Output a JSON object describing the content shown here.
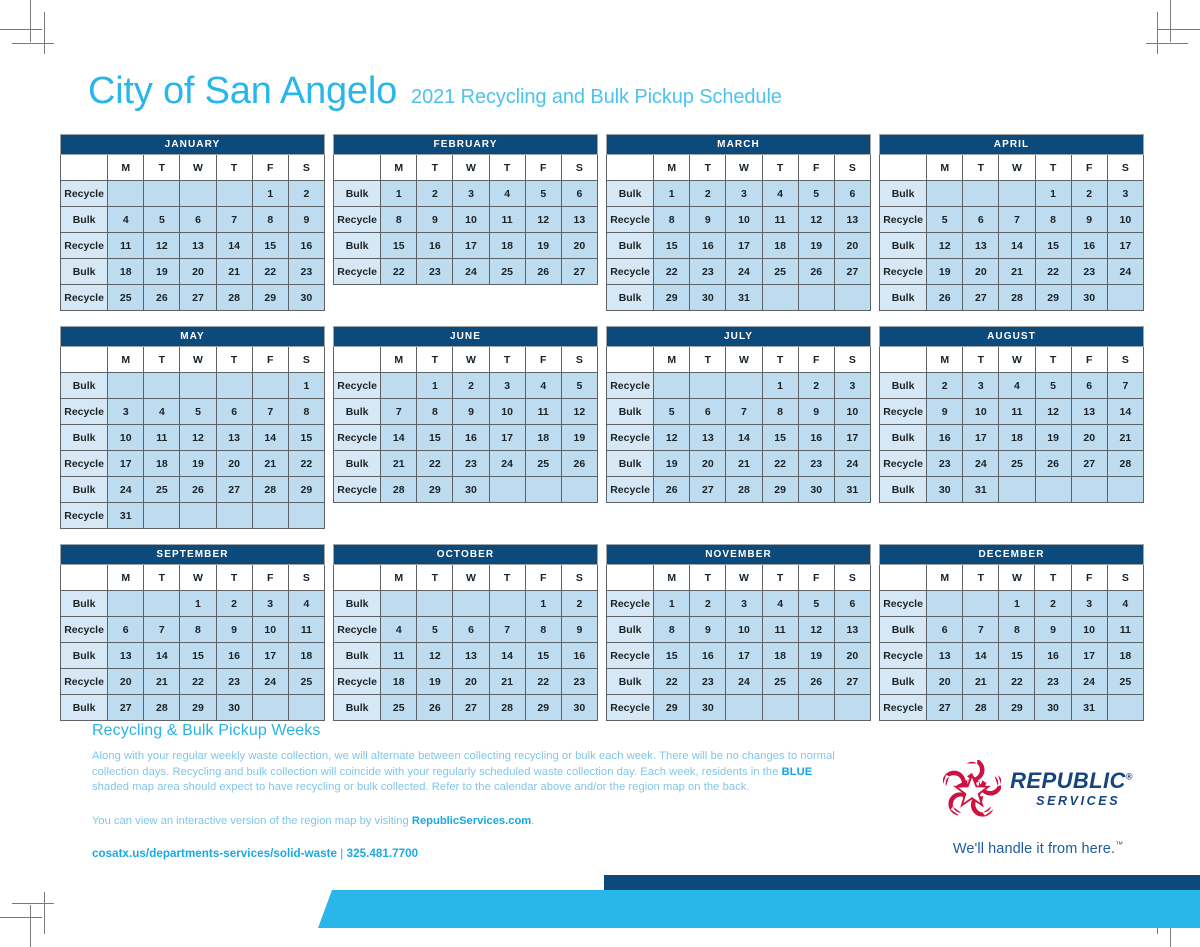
{
  "header": {
    "city": "City of San Angelo",
    "subtitle": "2021 Recycling and Bulk Pickup Schedule"
  },
  "colors": {
    "navy": "#0d4a7c",
    "cyan": "#29b6e8",
    "cell_blue": "#bddcef",
    "label_blue": "#d6e8f5",
    "logo_red": "#ce1141",
    "logo_navy": "#16457e"
  },
  "day_headers": [
    "M",
    "T",
    "W",
    "T",
    "F",
    "S"
  ],
  "labels": {
    "recycle": "Recycle",
    "bulk": "Bulk"
  },
  "calendar": {
    "year": "2021",
    "months": [
      {
        "name": "JANUARY",
        "weeks": [
          {
            "type": "Recycle",
            "days": [
              "",
              "",
              "",
              "",
              "1",
              "2"
            ]
          },
          {
            "type": "Bulk",
            "days": [
              "4",
              "5",
              "6",
              "7",
              "8",
              "9"
            ]
          },
          {
            "type": "Recycle",
            "days": [
              "11",
              "12",
              "13",
              "14",
              "15",
              "16"
            ]
          },
          {
            "type": "Bulk",
            "days": [
              "18",
              "19",
              "20",
              "21",
              "22",
              "23"
            ]
          },
          {
            "type": "Recycle",
            "days": [
              "25",
              "26",
              "27",
              "28",
              "29",
              "30"
            ]
          }
        ]
      },
      {
        "name": "FEBRUARY",
        "weeks": [
          {
            "type": "Bulk",
            "days": [
              "1",
              "2",
              "3",
              "4",
              "5",
              "6"
            ]
          },
          {
            "type": "Recycle",
            "days": [
              "8",
              "9",
              "10",
              "11",
              "12",
              "13"
            ]
          },
          {
            "type": "Bulk",
            "days": [
              "15",
              "16",
              "17",
              "18",
              "19",
              "20"
            ]
          },
          {
            "type": "Recycle",
            "days": [
              "22",
              "23",
              "24",
              "25",
              "26",
              "27"
            ]
          }
        ]
      },
      {
        "name": "MARCH",
        "weeks": [
          {
            "type": "Bulk",
            "days": [
              "1",
              "2",
              "3",
              "4",
              "5",
              "6"
            ]
          },
          {
            "type": "Recycle",
            "days": [
              "8",
              "9",
              "10",
              "11",
              "12",
              "13"
            ]
          },
          {
            "type": "Bulk",
            "days": [
              "15",
              "16",
              "17",
              "18",
              "19",
              "20"
            ]
          },
          {
            "type": "Recycle",
            "days": [
              "22",
              "23",
              "24",
              "25",
              "26",
              "27"
            ]
          },
          {
            "type": "Bulk",
            "days": [
              "29",
              "30",
              "31",
              "",
              "",
              ""
            ]
          }
        ]
      },
      {
        "name": "APRIL",
        "weeks": [
          {
            "type": "Bulk",
            "days": [
              "",
              "",
              "",
              "1",
              "2",
              "3"
            ]
          },
          {
            "type": "Recycle",
            "days": [
              "5",
              "6",
              "7",
              "8",
              "9",
              "10"
            ]
          },
          {
            "type": "Bulk",
            "days": [
              "12",
              "13",
              "14",
              "15",
              "16",
              "17"
            ]
          },
          {
            "type": "Recycle",
            "days": [
              "19",
              "20",
              "21",
              "22",
              "23",
              "24"
            ]
          },
          {
            "type": "Bulk",
            "days": [
              "26",
              "27",
              "28",
              "29",
              "30",
              ""
            ]
          }
        ]
      },
      {
        "name": "MAY",
        "weeks": [
          {
            "type": "Bulk",
            "days": [
              "",
              "",
              "",
              "",
              "",
              "1"
            ]
          },
          {
            "type": "Recycle",
            "days": [
              "3",
              "4",
              "5",
              "6",
              "7",
              "8"
            ]
          },
          {
            "type": "Bulk",
            "days": [
              "10",
              "11",
              "12",
              "13",
              "14",
              "15"
            ]
          },
          {
            "type": "Recycle",
            "days": [
              "17",
              "18",
              "19",
              "20",
              "21",
              "22"
            ]
          },
          {
            "type": "Bulk",
            "days": [
              "24",
              "25",
              "26",
              "27",
              "28",
              "29"
            ]
          },
          {
            "type": "Recycle",
            "days": [
              "31",
              "",
              "",
              "",
              "",
              ""
            ]
          }
        ]
      },
      {
        "name": "JUNE",
        "weeks": [
          {
            "type": "Recycle",
            "days": [
              "",
              "1",
              "2",
              "3",
              "4",
              "5"
            ]
          },
          {
            "type": "Bulk",
            "days": [
              "7",
              "8",
              "9",
              "10",
              "11",
              "12"
            ]
          },
          {
            "type": "Recycle",
            "days": [
              "14",
              "15",
              "16",
              "17",
              "18",
              "19"
            ]
          },
          {
            "type": "Bulk",
            "days": [
              "21",
              "22",
              "23",
              "24",
              "25",
              "26"
            ]
          },
          {
            "type": "Recycle",
            "days": [
              "28",
              "29",
              "30",
              "",
              "",
              ""
            ]
          }
        ]
      },
      {
        "name": "JULY",
        "weeks": [
          {
            "type": "Recycle",
            "days": [
              "",
              "",
              "",
              "1",
              "2",
              "3"
            ]
          },
          {
            "type": "Bulk",
            "days": [
              "5",
              "6",
              "7",
              "8",
              "9",
              "10"
            ]
          },
          {
            "type": "Recycle",
            "days": [
              "12",
              "13",
              "14",
              "15",
              "16",
              "17"
            ]
          },
          {
            "type": "Bulk",
            "days": [
              "19",
              "20",
              "21",
              "22",
              "23",
              "24"
            ]
          },
          {
            "type": "Recycle",
            "days": [
              "26",
              "27",
              "28",
              "29",
              "30",
              "31"
            ]
          }
        ]
      },
      {
        "name": "AUGUST",
        "weeks": [
          {
            "type": "Bulk",
            "days": [
              "2",
              "3",
              "4",
              "5",
              "6",
              "7"
            ]
          },
          {
            "type": "Recycle",
            "days": [
              "9",
              "10",
              "11",
              "12",
              "13",
              "14"
            ]
          },
          {
            "type": "Bulk",
            "days": [
              "16",
              "17",
              "18",
              "19",
              "20",
              "21"
            ]
          },
          {
            "type": "Recycle",
            "days": [
              "23",
              "24",
              "25",
              "26",
              "27",
              "28"
            ]
          },
          {
            "type": "Bulk",
            "days": [
              "30",
              "31",
              "",
              "",
              "",
              ""
            ]
          }
        ]
      },
      {
        "name": "SEPTEMBER",
        "weeks": [
          {
            "type": "Bulk",
            "days": [
              "",
              "",
              "1",
              "2",
              "3",
              "4"
            ]
          },
          {
            "type": "Recycle",
            "days": [
              "6",
              "7",
              "8",
              "9",
              "10",
              "11"
            ]
          },
          {
            "type": "Bulk",
            "days": [
              "13",
              "14",
              "15",
              "16",
              "17",
              "18"
            ]
          },
          {
            "type": "Recycle",
            "days": [
              "20",
              "21",
              "22",
              "23",
              "24",
              "25"
            ]
          },
          {
            "type": "Bulk",
            "days": [
              "27",
              "28",
              "29",
              "30",
              "",
              ""
            ]
          }
        ]
      },
      {
        "name": "OCTOBER",
        "weeks": [
          {
            "type": "Bulk",
            "days": [
              "",
              "",
              "",
              "",
              "1",
              "2"
            ]
          },
          {
            "type": "Recycle",
            "days": [
              "4",
              "5",
              "6",
              "7",
              "8",
              "9"
            ]
          },
          {
            "type": "Bulk",
            "days": [
              "11",
              "12",
              "13",
              "14",
              "15",
              "16"
            ]
          },
          {
            "type": "Recycle",
            "days": [
              "18",
              "19",
              "20",
              "21",
              "22",
              "23"
            ]
          },
          {
            "type": "Bulk",
            "days": [
              "25",
              "26",
              "27",
              "28",
              "29",
              "30"
            ]
          }
        ]
      },
      {
        "name": "NOVEMBER",
        "weeks": [
          {
            "type": "Recycle",
            "days": [
              "1",
              "2",
              "3",
              "4",
              "5",
              "6"
            ]
          },
          {
            "type": "Bulk",
            "days": [
              "8",
              "9",
              "10",
              "11",
              "12",
              "13"
            ]
          },
          {
            "type": "Recycle",
            "days": [
              "15",
              "16",
              "17",
              "18",
              "19",
              "20"
            ]
          },
          {
            "type": "Bulk",
            "days": [
              "22",
              "23",
              "24",
              "25",
              "26",
              "27"
            ]
          },
          {
            "type": "Recycle",
            "days": [
              "29",
              "30",
              "",
              "",
              "",
              ""
            ]
          }
        ]
      },
      {
        "name": "DECEMBER",
        "weeks": [
          {
            "type": "Recycle",
            "days": [
              "",
              "",
              "1",
              "2",
              "3",
              "4"
            ]
          },
          {
            "type": "Bulk",
            "days": [
              "6",
              "7",
              "8",
              "9",
              "10",
              "11"
            ]
          },
          {
            "type": "Recycle",
            "days": [
              "13",
              "14",
              "15",
              "16",
              "17",
              "18"
            ]
          },
          {
            "type": "Bulk",
            "days": [
              "20",
              "21",
              "22",
              "23",
              "24",
              "25"
            ]
          },
          {
            "type": "Recycle",
            "days": [
              "27",
              "28",
              "29",
              "30",
              "31",
              ""
            ]
          }
        ]
      }
    ]
  },
  "footer": {
    "heading": "Recycling & Bulk Pickup Weeks",
    "paragraph_part1": "Along with your regular weekly waste collection, we will alternate between collecting recycling or bulk each week. There will be no changes to normal collection days. Recycling and bulk collection will coincide with your regularly scheduled waste collection day. Each week, residents in the ",
    "paragraph_highlight": "BLUE",
    "paragraph_part2": " shaded map area should expect to have recycling or bulk collected. Refer to the calendar above and/or the region map on the back.",
    "paragraph2_part1": "You can view an interactive version of the region map by visiting ",
    "paragraph2_link": "RepublicServices.com",
    "paragraph2_part2": ".",
    "contact_url": "cosatx.us/departments-services/solid-waste",
    "contact_separator": " | ",
    "contact_phone": "325.481.7700"
  },
  "logo": {
    "name_line1": "REPUBLIC",
    "name_line2": "SERVICES",
    "trademark": "®",
    "tagline": "We'll handle it from here.",
    "tagline_mark": "™"
  }
}
